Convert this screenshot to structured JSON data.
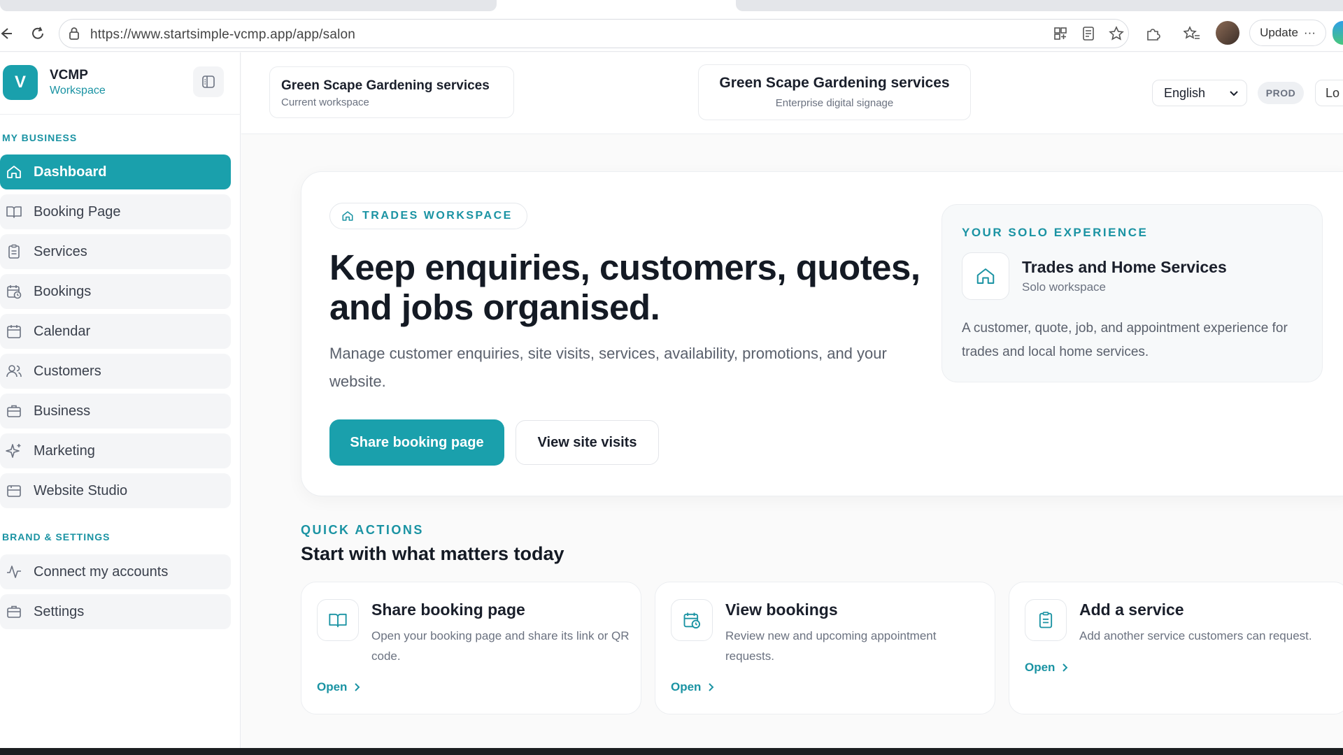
{
  "browser": {
    "url": "https://www.startsimple-vcmp.app/app/salon",
    "update_label": "Update",
    "more_label": "···"
  },
  "sidebar": {
    "brand_initial": "V",
    "brand_name": "VCMP",
    "brand_sub": "Workspace",
    "section_business": "MY BUSINESS",
    "section_settings": "BRAND & SETTINGS",
    "items": [
      {
        "label": "Dashboard",
        "icon": "home-icon",
        "active": true
      },
      {
        "label": "Booking Page",
        "icon": "book-open-icon"
      },
      {
        "label": "Services",
        "icon": "clipboard-icon"
      },
      {
        "label": "Bookings",
        "icon": "calendar-clock-icon"
      },
      {
        "label": "Calendar",
        "icon": "calendar-icon"
      },
      {
        "label": "Customers",
        "icon": "users-icon"
      },
      {
        "label": "Business",
        "icon": "briefcase-icon"
      },
      {
        "label": "Marketing",
        "icon": "sparkles-icon"
      },
      {
        "label": "Website Studio",
        "icon": "browser-icon"
      }
    ],
    "settings_items": [
      {
        "label": "Connect my accounts",
        "icon": "activity-icon"
      },
      {
        "label": "Settings",
        "icon": "briefcase-icon"
      }
    ]
  },
  "header": {
    "workspace_title": "Green Scape Gardening services",
    "workspace_sub": "Current workspace",
    "org_title": "Green Scape Gardening services",
    "org_sub": "Enterprise digital signage",
    "language": "English",
    "env_badge": "PROD",
    "logout_label": "Lo"
  },
  "hero": {
    "badge": "TRADES WORKSPACE",
    "title": "Keep enquiries, customers, quotes, and jobs organised.",
    "description": "Manage customer enquiries, site visits, services, availability, promotions, and your website.",
    "primary_btn": "Share booking page",
    "secondary_btn": "View site visits",
    "solo": {
      "label": "YOUR SOLO EXPERIENCE",
      "title": "Trades and Home Services",
      "subtitle": "Solo workspace",
      "description": "A customer, quote, job, and appointment experience for trades and local home services."
    }
  },
  "quick_actions": {
    "label": "QUICK ACTIONS",
    "title": "Start with what matters today",
    "cards": [
      {
        "title": "Share booking page",
        "description": "Open your booking page and share its link or QR code.",
        "link": "Open",
        "icon": "book-open-icon"
      },
      {
        "title": "View bookings",
        "description": "Review new and upcoming appointment requests.",
        "link": "Open",
        "icon": "calendar-clock-icon"
      },
      {
        "title": "Add a service",
        "description": "Add another service customers can request.",
        "link": "Open",
        "icon": "clipboard-icon"
      }
    ]
  },
  "colors": {
    "accent": "#1aa0ac",
    "accent_text": "#1a93a3"
  }
}
